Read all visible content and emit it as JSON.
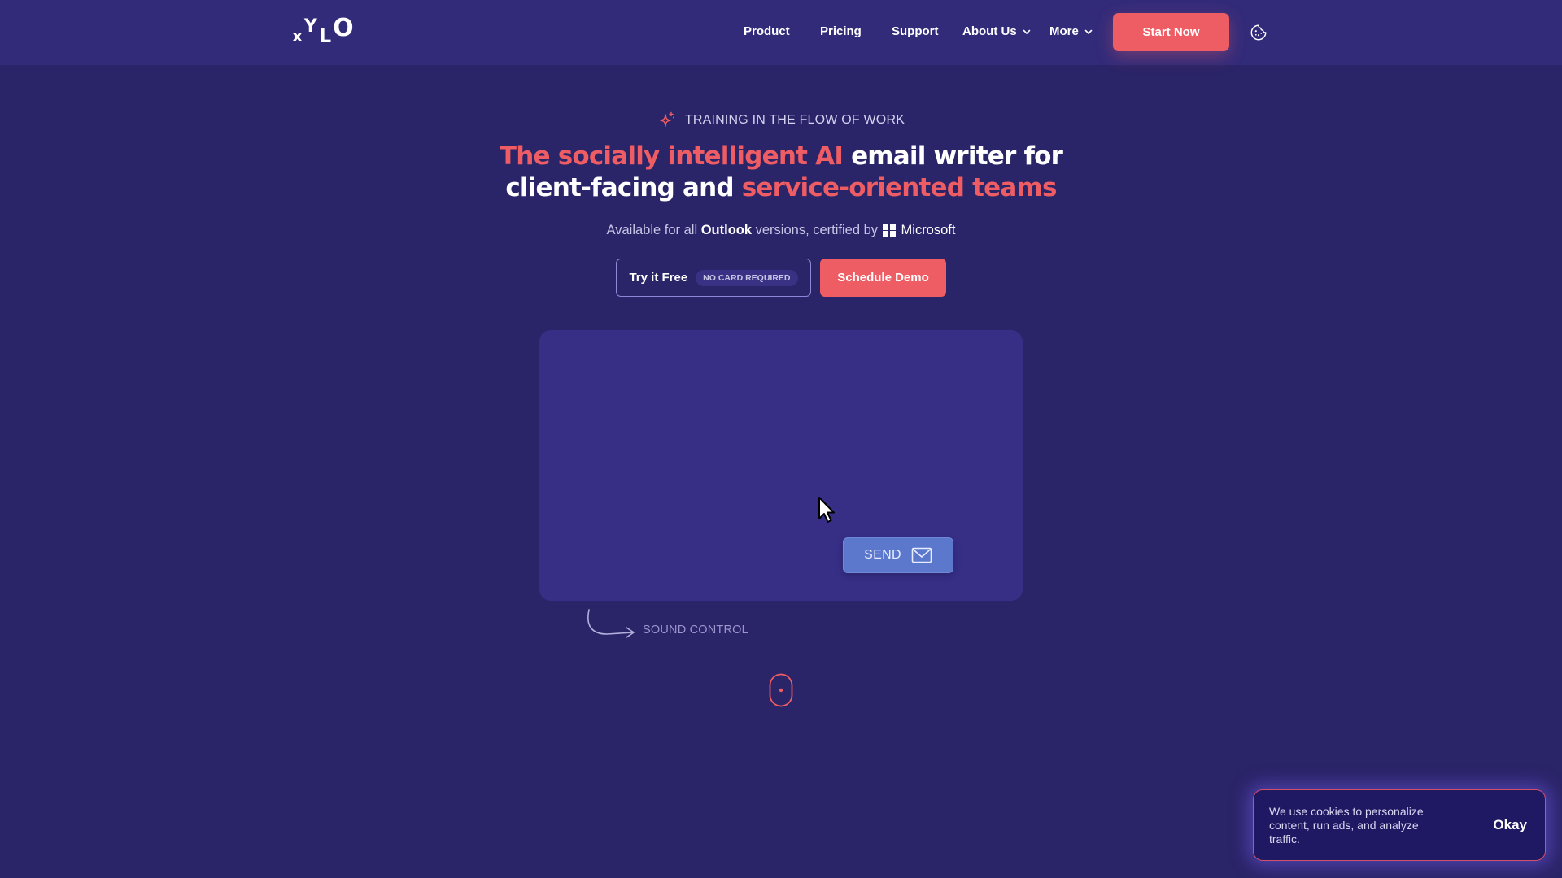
{
  "header": {
    "logo": {
      "letters": [
        "x",
        "Y",
        "L",
        "O"
      ],
      "alt": "xYLO"
    },
    "nav": [
      {
        "label": "Product",
        "has_dropdown": false
      },
      {
        "label": "Pricing",
        "has_dropdown": false
      },
      {
        "label": "Support",
        "has_dropdown": false
      },
      {
        "label": "About Us",
        "has_dropdown": true
      },
      {
        "label": "More",
        "has_dropdown": true
      }
    ],
    "cta_label": "Start Now",
    "cookie_icon": "cookie-icon"
  },
  "hero": {
    "eyebrow_icon": "sparkle-icon",
    "eyebrow": "TRAINING IN THE FLOW OF WORK",
    "headline": {
      "line1_accent": "The socially intelligent AI",
      "line1_plain": " email writer for",
      "line2_plain": "client-facing and ",
      "line2_accent": "service-oriented teams"
    },
    "subline": {
      "prefix": "Available for all ",
      "bold": "Outlook",
      "middle": " versions, certified by",
      "brand_icon": "windows-logo-icon",
      "brand": "Microsoft"
    },
    "buttons": {
      "try_label": "Try it Free",
      "try_badge": "NO CARD REQUIRED",
      "demo_label": "Schedule Demo"
    }
  },
  "demo": {
    "send_label": "SEND",
    "send_icon": "envelope-icon",
    "sound_control_label": "SOUND CONTROL"
  },
  "scroll_indicator": "mouse-scroll-icon",
  "cookie_banner": {
    "message": "We use cookies to personalize content, run ads, and analyze traffic.",
    "button_label": "Okay"
  },
  "colors": {
    "background": "#2a2468",
    "header": "#322b7a",
    "accent": "#ef5d64",
    "card": "#372f86",
    "send_button": "#5b78cc"
  }
}
